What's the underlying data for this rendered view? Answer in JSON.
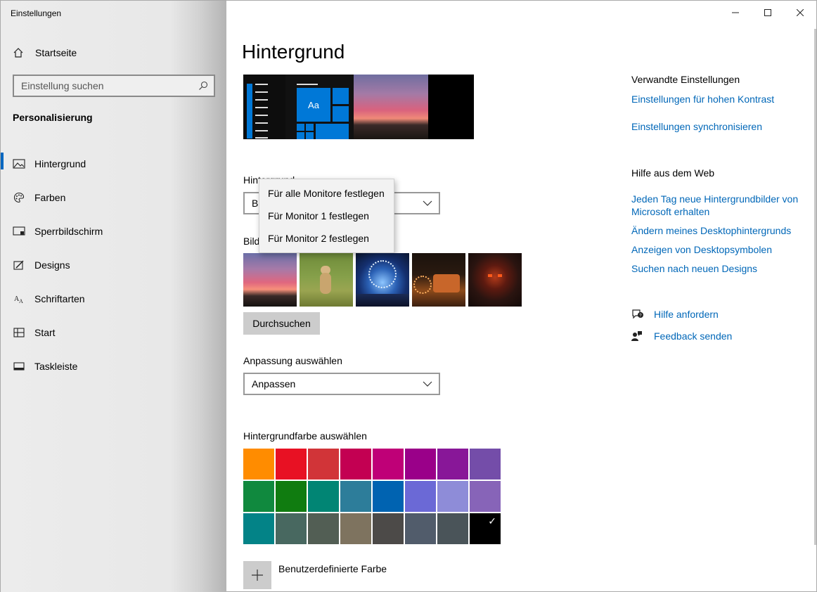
{
  "window": {
    "title": "Einstellungen"
  },
  "sidebar": {
    "home_label": "Startseite",
    "search_placeholder": "Einstellung suchen",
    "section_title": "Personalisierung",
    "items": [
      {
        "label": "Hintergrund",
        "icon": "picture-icon",
        "active": true
      },
      {
        "label": "Farben",
        "icon": "palette-icon",
        "active": false
      },
      {
        "label": "Sperrbildschirm",
        "icon": "lock-screen-icon",
        "active": false
      },
      {
        "label": "Designs",
        "icon": "brush-icon",
        "active": false
      },
      {
        "label": "Schriftarten",
        "icon": "font-icon",
        "active": false
      },
      {
        "label": "Start",
        "icon": "start-icon",
        "active": false
      },
      {
        "label": "Taskleiste",
        "icon": "taskbar-icon",
        "active": false
      }
    ]
  },
  "main": {
    "title": "Hintergrund",
    "preview_tile_text": "Aa",
    "background_label": "Hintergrund",
    "background_select_value": "Bild",
    "images_label": "Bild auswählen",
    "browse_label": "Durchsuchen",
    "fit_label": "Anpassung auswählen",
    "fit_value": "Anpassen",
    "color_label": "Hintergrundfarbe auswählen",
    "colors": [
      "#ff8c00",
      "#e81123",
      "#d13438",
      "#c30052",
      "#bf0077",
      "#9a0089",
      "#881798",
      "#744da9",
      "#10893e",
      "#107c10",
      "#018574",
      "#2d7d9a",
      "#0063b1",
      "#6b69d6",
      "#8e8cd8",
      "#8764b8",
      "#038387",
      "#486860",
      "#525e54",
      "#7e735f",
      "#4c4a48",
      "#515c6b",
      "#4a5459",
      "#000000"
    ],
    "selected_color": "#000000",
    "custom_color_label": "Benutzerdefinierte Farbe"
  },
  "flyout": {
    "items": [
      "Für alle Monitore festlegen",
      "Für Monitor 1 festlegen",
      "Für Monitor 2 festlegen"
    ]
  },
  "related": {
    "heading": "Verwandte Einstellungen",
    "links": [
      "Einstellungen für hohen Kontrast",
      "Einstellungen synchronisieren"
    ]
  },
  "web_help": {
    "heading": "Hilfe aus dem Web",
    "links": [
      "Jeden Tag neue Hintergrundbilder von Microsoft erhalten",
      "Ändern meines Desktophintergrunds",
      "Anzeigen von Desktopsymbolen",
      "Suchen nach neuen Designs"
    ]
  },
  "actions": {
    "help": "Hilfe anfordern",
    "feedback": "Feedback senden"
  }
}
